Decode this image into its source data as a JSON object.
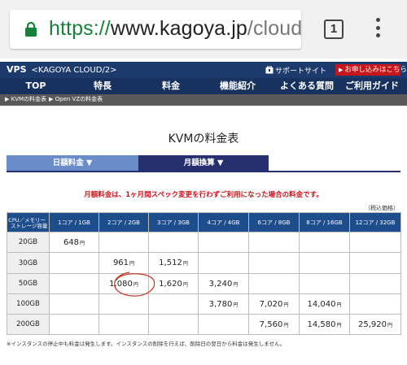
{
  "browser": {
    "url_scheme": "https://",
    "url_host": "www.kagoya.jp",
    "url_path": "/cloud/v",
    "tab_count": "1",
    "icons": [
      "lock-icon",
      "tab-switcher-icon",
      "overflow-menu-icon"
    ]
  },
  "site": {
    "brand": "VPS",
    "brand_sub": "<KAGOYA CLOUD/2>",
    "support_label": "サポートサイト",
    "apply_label": "お申し込みはこちら"
  },
  "nav": {
    "items": [
      "TOP",
      "特長",
      "料金",
      "機能紹介",
      "よくある質問",
      "ご利用ガイド"
    ],
    "active": "料金"
  },
  "breadcrumb": [
    "KVMの料金表",
    "Open VZの料金表"
  ],
  "main": {
    "title": "KVMの料金表",
    "tab_daily": "日額料金 ▼",
    "tab_monthly": "月額換算 ▼",
    "notice": "月額料金は、1ヶ月間スペック変更を行わずご利用になった場合の料金です。",
    "tax_note": "（税込価格）",
    "footnote": "※インスタンスの停止中も料金は発生します。インスタンスの削除を行えば、削除日の翌日から料金は発生しません。"
  },
  "table": {
    "corner_top": "CPU／メモリー",
    "corner_bottom": "ストレージ容量",
    "columns": [
      "1コア / 1GB",
      "2コア / 2GB",
      "3コア / 3GB",
      "4コア / 4GB",
      "6コア / 8GB",
      "8コア / 16GB",
      "12コア / 32GB"
    ],
    "yen_unit": "円",
    "rows": [
      {
        "storage": "20GB",
        "cells": [
          "648",
          "",
          "",
          "",
          "",
          "",
          ""
        ]
      },
      {
        "storage": "30GB",
        "cells": [
          "",
          "961",
          "1,512",
          "",
          "",
          "",
          ""
        ]
      },
      {
        "storage": "50GB",
        "cells": [
          "",
          "1,080",
          "1,620",
          "3,240",
          "",
          "",
          ""
        ]
      },
      {
        "storage": "100GB",
        "cells": [
          "",
          "",
          "",
          "3,780",
          "7,020",
          "14,040",
          ""
        ]
      },
      {
        "storage": "200GB",
        "cells": [
          "",
          "",
          "",
          "",
          "7,560",
          "14,580",
          "25,920"
        ]
      }
    ]
  },
  "colors": {
    "url_scheme": "#188038",
    "header": "#1d3a6d",
    "apply_button": "#c8161d",
    "tab_daily": "#6a8dc9",
    "tab_monthly": "#27306f",
    "table_header": "#1e4d8c",
    "annotation_circle": "#c0392b"
  }
}
